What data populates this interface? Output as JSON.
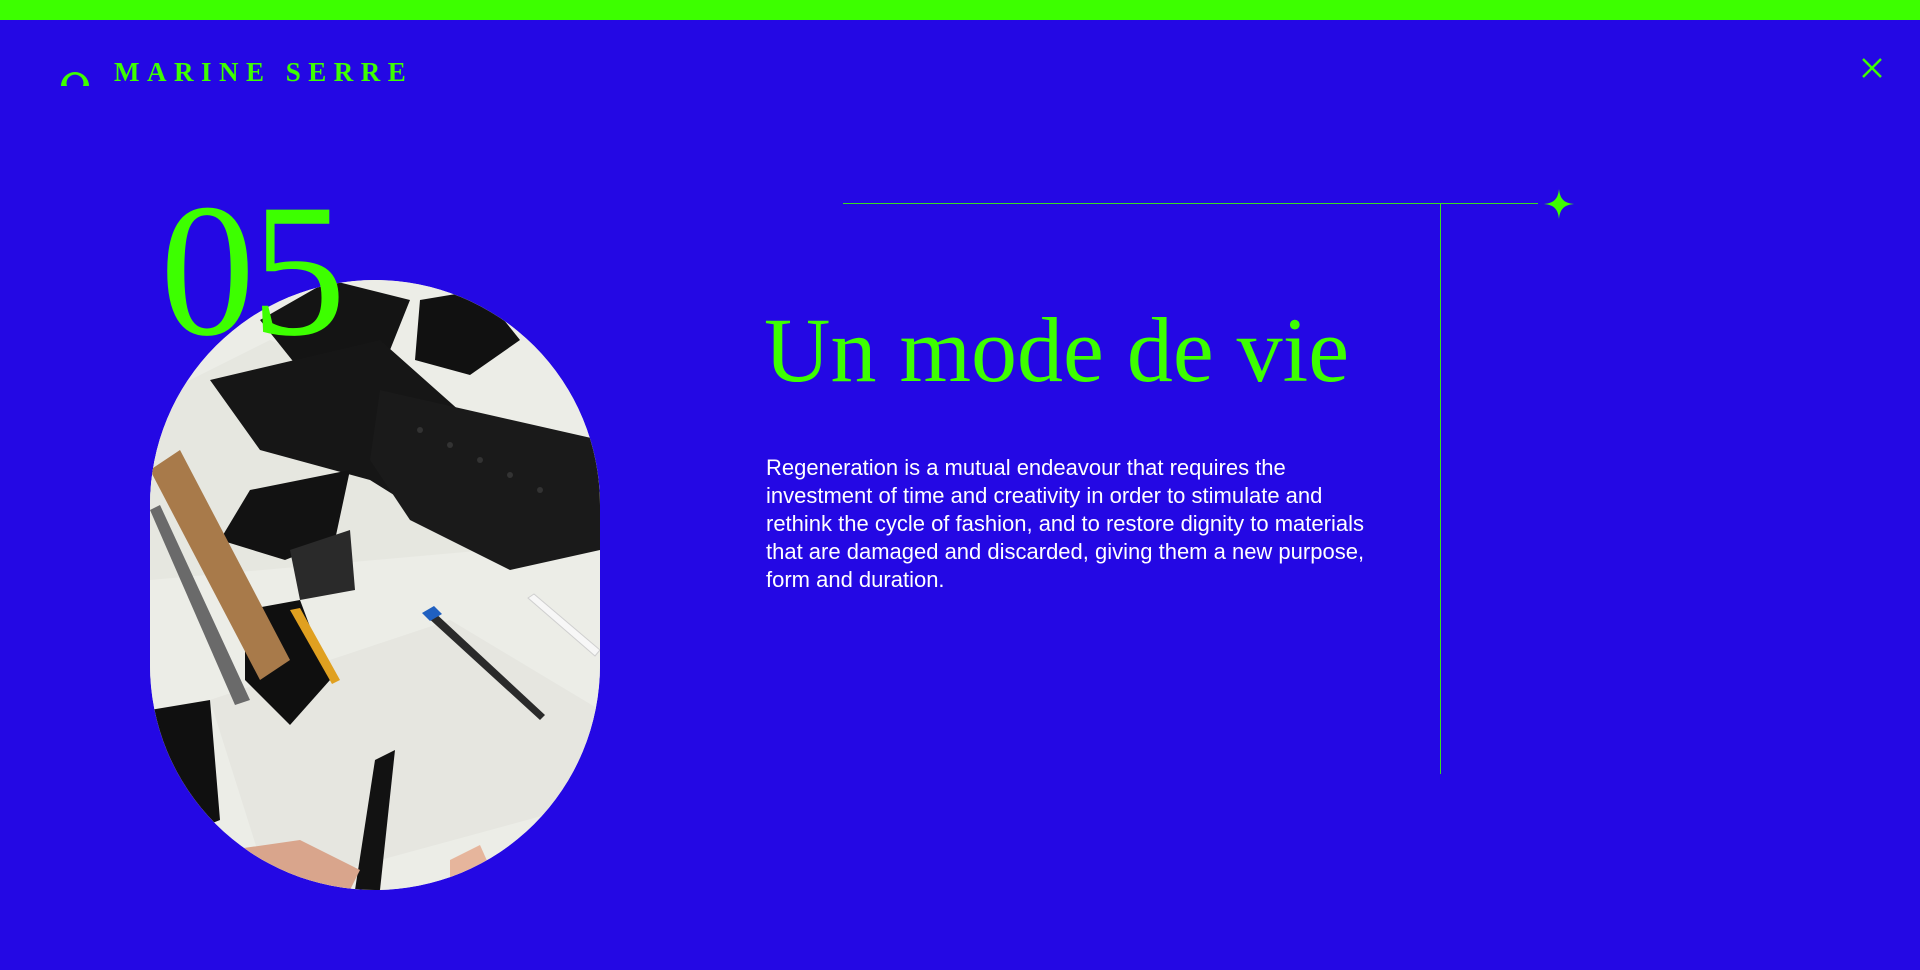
{
  "brand": {
    "name": "MARINE SERRE",
    "logo_icon": "crescent-moon-icon"
  },
  "header": {
    "close_icon": "close-icon"
  },
  "decor": {
    "sparkle_icon": "sparkle-icon"
  },
  "section": {
    "number": "05",
    "title": "Un mode de vie",
    "body": "Regeneration is a mutual endeavour that requires the investment of time and creativity in order to stimulate and rethink the cycle of fashion, and to restore dignity to materials that are damaged and discarded, giving them a new purpose, form and duration."
  },
  "colors": {
    "background": "#2408e4",
    "accent": "#3dff00",
    "text": "#ffffff"
  }
}
